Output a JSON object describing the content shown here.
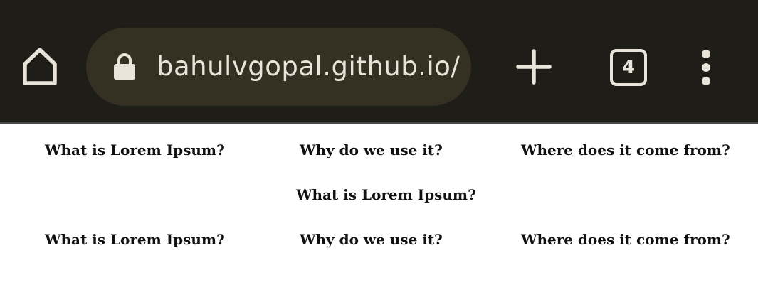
{
  "browser": {
    "url": "bahulvgopal.github.io/",
    "tab_count": "4",
    "icons": {
      "home": "home-icon",
      "lock": "lock-icon",
      "new_tab": "plus-icon",
      "tabs": "tab-switcher-icon",
      "menu": "more-vert-icon"
    },
    "colors": {
      "toolbar_bg": "#1e1d18",
      "omnibox_bg": "#343022",
      "icon_fg": "#e8e4da"
    }
  },
  "page": {
    "rows": [
      {
        "items": [
          "What is Lorem Ipsum?",
          "Why do we use it?",
          "Where does it come from?"
        ]
      },
      {
        "items": [
          "What is Lorem Ipsum?"
        ]
      },
      {
        "items": [
          "What is Lorem Ipsum?",
          "Why do we use it?",
          "Where does it come from?"
        ]
      }
    ]
  }
}
